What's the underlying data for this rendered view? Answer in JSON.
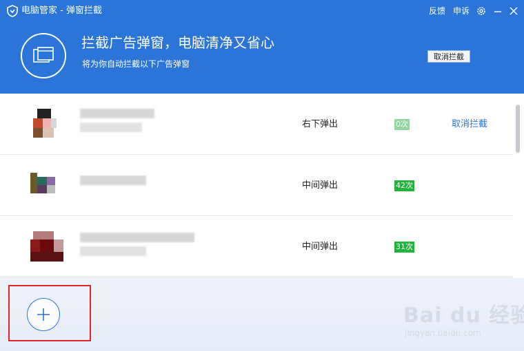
{
  "titlebar": {
    "title": "电脑管家 - 弹窗拦截",
    "feedback": "反馈",
    "complain": "申诉",
    "settings_icon": "gear-icon",
    "minimize_icon": "minimize-icon",
    "close_icon": "close-icon"
  },
  "header": {
    "title": "拦截广告弹窗，电脑清净又省心",
    "subtitle": "将为你自动拦截以下广告弹窗",
    "cancel_all": "取消拦截"
  },
  "rows": [
    {
      "position": "右下弹出",
      "count": "0次",
      "action": "取消拦截"
    },
    {
      "position": "中间弹出",
      "count": "42次"
    },
    {
      "position": "中间弹出",
      "count": "31次"
    }
  ],
  "footer": {
    "add_icon": "plus-icon"
  },
  "watermark": {
    "text": "Bai du 经验",
    "sub": "jingyan.baidu.com"
  },
  "colors": {
    "primary": "#2b74d8",
    "count_badge": "#23b23b",
    "highlight_box": "#e02424"
  }
}
